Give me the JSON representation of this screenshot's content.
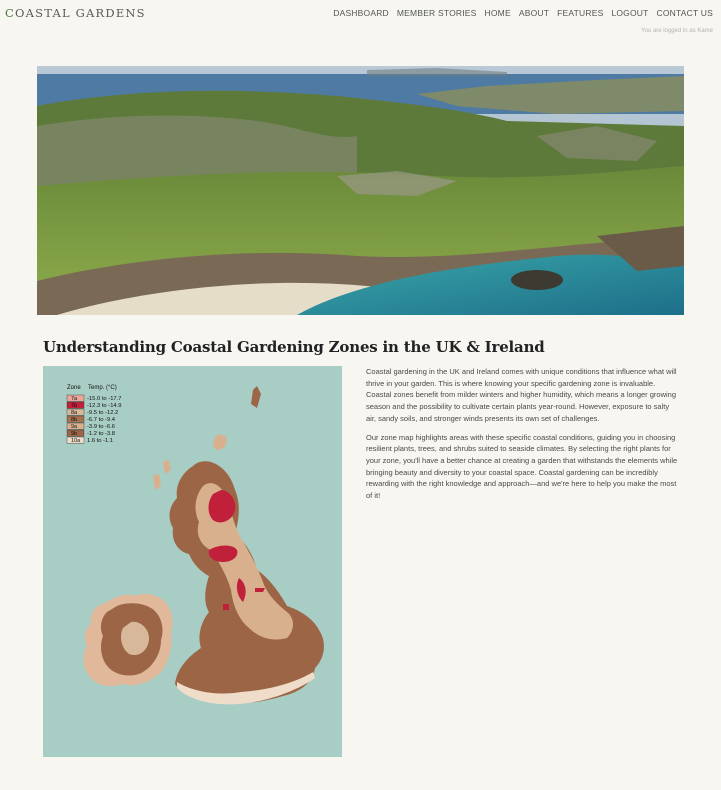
{
  "header": {
    "logo_first": "C",
    "logo_rest": "OASTAL GARDENS",
    "nav": [
      "DASHBOARD",
      "MEMBER STORIES",
      "HOME",
      "ABOUT",
      "FEATURES",
      "LOGOUT",
      "CONTACT US"
    ],
    "logged_in": "You are logged in as Kame"
  },
  "article": {
    "title": "Understanding Coastal Gardening Zones in the UK & Ireland",
    "paragraphs": [
      "Coastal gardening in the UK and Ireland comes with unique conditions that influence what will thrive in your garden. This is where knowing your specific gardening zone is invaluable. Coastal zones benefit from milder winters and higher humidity, which means a longer growing season and the possibility to cultivate certain plants year-round. However, exposure to salty air, sandy soils, and stronger winds presents its own set of challenges.",
      "Our zone map highlights areas with these specific coastal conditions, guiding you in choosing resilient plants, trees, and shrubs suited to seaside climates. By selecting the right plants for your zone, you'll have a better chance at creating a garden that withstands the elements while bringing beauty and diversity to your coastal space. Coastal gardening can be incredibly rewarding with the right knowledge and approach—and we're here to help you make the most of it!"
    ]
  },
  "map_legend": {
    "header_zone": "Zone",
    "header_temp": "Temp. (°C)",
    "rows": [
      {
        "zone": "7a",
        "temp": "-15.0 to -17.7",
        "color": "#e9a79a"
      },
      {
        "zone": "7b",
        "temp": "-12.3 to -14.9",
        "color": "#c0203a"
      },
      {
        "zone": "8a",
        "temp": "-9.5 to -12.2",
        "color": "#d8b89a"
      },
      {
        "zone": "8b",
        "temp": "-6.7 to -9.4",
        "color": "#a87350"
      },
      {
        "zone": "9a",
        "temp": "-3.9 to -6.6",
        "color": "#d9b08e"
      },
      {
        "zone": "9b",
        "temp": "-1.2 to -3.8",
        "color": "#9c6546"
      },
      {
        "zone": "10a",
        "temp": "1.6 to -1.1",
        "color": "#f0ddc9"
      }
    ]
  }
}
